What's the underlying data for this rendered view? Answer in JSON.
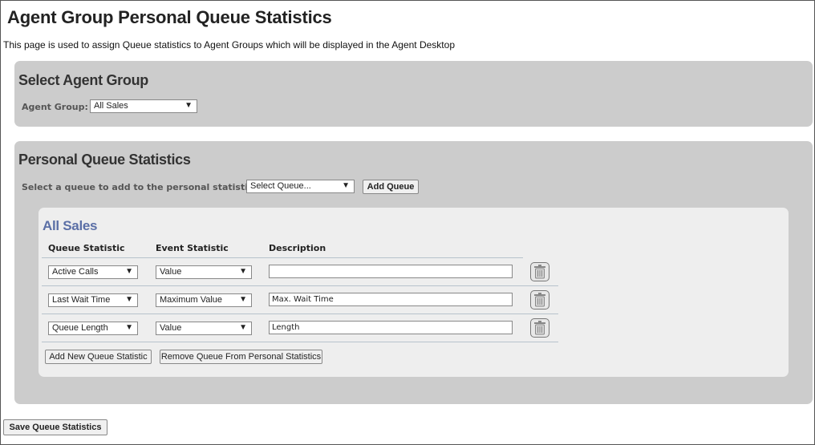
{
  "page": {
    "title": "Agent Group Personal Queue Statistics",
    "description": "This page is used to assign Queue statistics to Agent Groups which will be displayed in the Agent Desktop"
  },
  "select_group": {
    "title": "Select Agent Group",
    "label": "Agent Group:",
    "value": "All Sales"
  },
  "personal_stats": {
    "title": "Personal Queue Statistics",
    "queue_label": "Select a queue to add to the personal statistics:",
    "queue_select_value": "Select Queue...",
    "add_queue_label": "Add Queue"
  },
  "queue_block": {
    "title": "All Sales",
    "columns": {
      "queue_statistic": "Queue Statistic",
      "event_statistic": "Event Statistic",
      "description": "Description"
    },
    "rows": [
      {
        "queue_statistic": "Active Calls",
        "event_statistic": "Value",
        "description": ""
      },
      {
        "queue_statistic": "Last Wait Time",
        "event_statistic": "Maximum Value",
        "description": "Max. Wait Time"
      },
      {
        "queue_statistic": "Queue Length",
        "event_statistic": "Value",
        "description": "Length"
      }
    ],
    "add_stat_label": "Add New Queue Statistic",
    "remove_queue_label": "Remove Queue From Personal Statistics"
  },
  "save_label": "Save Queue Statistics",
  "icons": {
    "dropdown": "chevron-down-icon",
    "delete": "trash-icon"
  },
  "colors": {
    "panel_bg": "#cccccc",
    "inner_bg": "#eeeeee",
    "queue_title": "#5b6fa6"
  }
}
